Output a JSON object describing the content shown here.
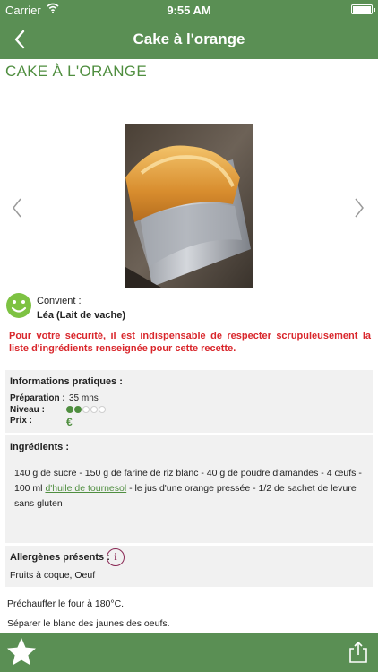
{
  "status_bar": {
    "carrier": "Carrier",
    "time": "9:55 AM"
  },
  "nav": {
    "title": "Cake à l'orange"
  },
  "recipe": {
    "title": "CAKE À L'ORANGE"
  },
  "suitability": {
    "label": "Convient :",
    "value": "Léa (Lait de vache)"
  },
  "warning": "Pour votre sécurité, il est indispensable de respecter scrupuleusement la liste d'ingrédients renseignée pour cette recette.",
  "practical": {
    "heading": "Informations pratiques :",
    "preparation_label": "Préparation :",
    "preparation_value": "35 mns",
    "level_label": "Niveau :",
    "level": {
      "value": 2,
      "max": 5
    },
    "price_label": "Prix :",
    "price_value": "€"
  },
  "ingredients": {
    "heading": "Ingrédients :",
    "text_before": "140 g de sucre - 150 g de farine de riz blanc - 40 g de poudre d'amandes - 4 œufs - 100 ml ",
    "link": "d'huile de tournesol",
    "text_after": " - le jus d'une orange pressée - 1/2 de sachet de levure sans gluten"
  },
  "allergens": {
    "heading": "Allergènes présents :",
    "info_icon": "i",
    "list": "Fruits à coque, Oeuf"
  },
  "steps": [
    "Préchauffer le four à 180°C.",
    "Séparer le blanc des jaunes des oeufs."
  ],
  "icons": {
    "back": "chevron-left-icon",
    "prev": "chevron-left-icon",
    "next": "chevron-right-icon",
    "smiley": "smiley-icon",
    "favorite": "star-icon",
    "share": "share-icon",
    "wifi": "wifi-icon",
    "battery": "battery-icon"
  },
  "colors": {
    "brand_green": "#5a8f54",
    "accent_green": "#4f8e3f",
    "warning_red": "#d9262b",
    "card_bg": "#f1f1f1"
  }
}
